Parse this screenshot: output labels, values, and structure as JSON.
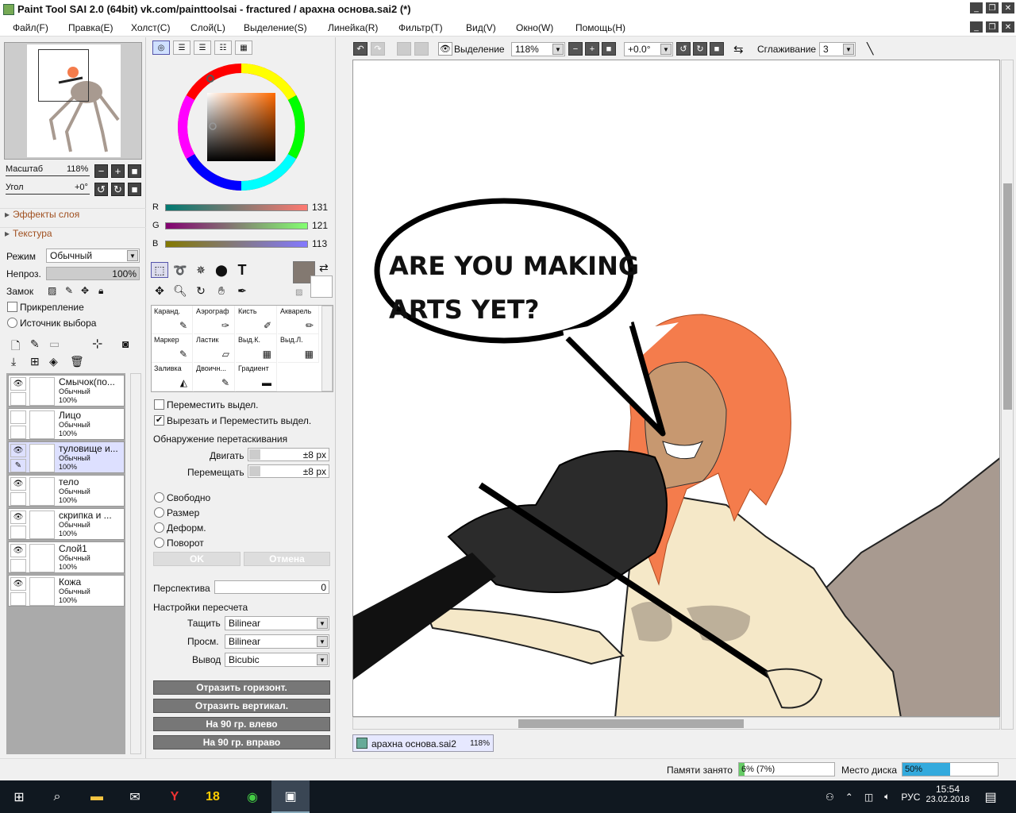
{
  "window": {
    "title": "Paint Tool SAI 2.0 (64bit) vk.com/painttoolsai - fractured / арахна основа.sai2 (*)",
    "buttons": [
      "_",
      "❐",
      "✕"
    ]
  },
  "menu": [
    "Файл(F)",
    "Правка(E)",
    "Холст(C)",
    "Слой(L)",
    "Выделение(S)",
    "Линейка(R)",
    "Фильтр(T)",
    "Вид(V)",
    "Окно(W)",
    "Помощь(H)"
  ],
  "navigator": {
    "zoom_label": "Масштаб",
    "zoom_value": "118%",
    "angle_label": "Угол",
    "angle_value": "+0°"
  },
  "layer_panel": {
    "effects": "Эффекты слоя",
    "texture": "Текстура",
    "mode_label": "Режим",
    "mode_value": "Обычный",
    "opacity_label": "Непроз.",
    "opacity_value": "100%",
    "lock_label": "Замок",
    "clip_label": "Прикрепление",
    "source_label": "Источник выбора",
    "layers": [
      {
        "name": "Смычок(по...",
        "mode": "Обычный",
        "opacity": "100%",
        "visible": true,
        "selected": false
      },
      {
        "name": "Лицо",
        "mode": "Обычный",
        "opacity": "100%",
        "visible": false,
        "selected": false
      },
      {
        "name": "туловище и...",
        "mode": "Обычный",
        "opacity": "100%",
        "visible": true,
        "selected": true
      },
      {
        "name": "тело",
        "mode": "Обычный",
        "opacity": "100%",
        "visible": true,
        "selected": false
      },
      {
        "name": "скрипка и ...",
        "mode": "Обычный",
        "opacity": "100%",
        "visible": true,
        "selected": false
      },
      {
        "name": "Слой1",
        "mode": "Обычный",
        "opacity": "100%",
        "visible": true,
        "selected": false
      },
      {
        "name": "Кожа",
        "mode": "Обычный",
        "opacity": "100%",
        "visible": true,
        "selected": false
      }
    ]
  },
  "color": {
    "r": "131",
    "g": "121",
    "b": "113",
    "r_label": "R",
    "g_label": "G",
    "b_label": "B",
    "current": "#837971"
  },
  "brushes": [
    {
      "label": "Каранд.",
      "icon": "✎"
    },
    {
      "label": "Аэрограф",
      "icon": "✑"
    },
    {
      "label": "Кисть",
      "icon": "✐"
    },
    {
      "label": "Акварель",
      "icon": "✏"
    },
    {
      "label": "Маркер",
      "icon": "✎"
    },
    {
      "label": "Ластик",
      "icon": "▱"
    },
    {
      "label": "Выд.К.",
      "icon": "▦"
    },
    {
      "label": "Выд.Л.",
      "icon": "▦"
    },
    {
      "label": "Заливка",
      "icon": "◭"
    },
    {
      "label": "Двоичн...",
      "icon": "✎"
    },
    {
      "label": "Градиент",
      "icon": "▬"
    }
  ],
  "transform": {
    "move_sel": "Переместить выдел.",
    "cut_move_sel": "Вырезать и Переместить выдел.",
    "drag_detect": "Обнаружение перетаскивания",
    "move_label": "Двигать",
    "move_value": "±8 px",
    "shift_label": "Перемещать",
    "shift_value": "±8 px",
    "modes": [
      "Свободно",
      "Размер",
      "Деформ.",
      "Поворот"
    ],
    "ok": "OK",
    "cancel": "Отмена",
    "perspective_label": "Перспектива",
    "perspective_value": "0",
    "resample_label": "Настройки пересчета",
    "drag_label": "Тащить",
    "drag_value": "Bilinear",
    "preview_label": "Просм.",
    "preview_value": "Bilinear",
    "output_label": "Вывод",
    "output_value": "Bicubic",
    "flip_h": "Отразить горизонт.",
    "flip_v": "Отразить вертикал.",
    "rot_left": "На 90 гр. влево",
    "rot_right": "На 90 гр. вправо"
  },
  "canvas_toolbar": {
    "selection_label": "Выделение",
    "zoom": "118%",
    "angle": "+0.0°",
    "smoothing_label": "Сглаживание",
    "smoothing_value": "3"
  },
  "artwork": {
    "speech_line1": "ARE YOU MAKING",
    "speech_line2": "ARTS YET?"
  },
  "document_tab": {
    "name": "арахна основа.sai2",
    "zoom": "118%"
  },
  "status": {
    "memory_label": "Памяти занято",
    "memory_value": "6% (7%)",
    "memory_fraction": 0.06,
    "disk_label": "Место диска",
    "disk_value": "50%",
    "disk_fraction": 0.5
  },
  "taskbar": {
    "time": "15:54",
    "date": "23.02.2018",
    "lang": "РУС"
  },
  "colors": {
    "hair": "#f47c4c",
    "skin": "#f5e8c8",
    "spider": "#a89a90",
    "violin": "#2b2b2b"
  }
}
